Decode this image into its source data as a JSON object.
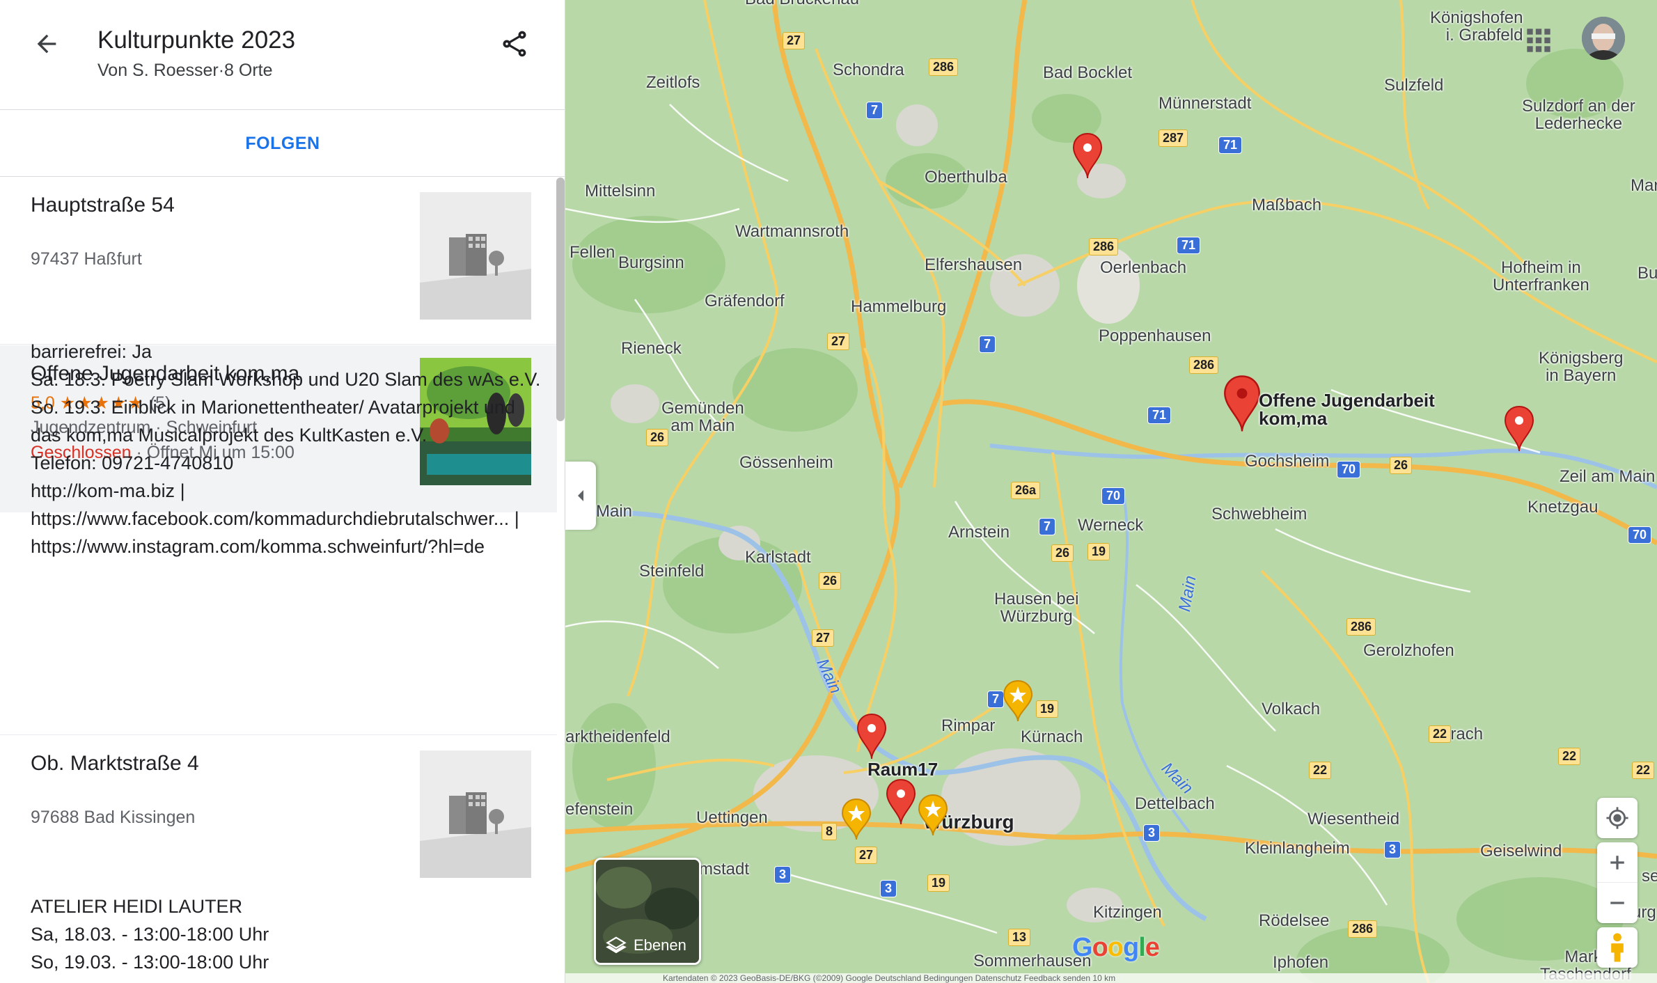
{
  "panel": {
    "title": "Kulturpunkte 2023",
    "subtitle": "Von S. Roesser·8 Orte",
    "follow_label": "FOLGEN",
    "items": [
      {
        "name": "Hauptstraße 54",
        "address": "97437 Haßfurt"
      },
      {
        "name": "Offene Jugendarbeit kom,ma",
        "rating": "5,0",
        "stars": "★★★★★",
        "review_count": "(5)",
        "category": "Jugendzentrum · Schweinfurt",
        "status": "Geschlossen",
        "hours": "· Öffnet Mi um 15:00",
        "description_lines": [
          "barrierefrei: Ja",
          "Sa. 18.3. Poetry Slam Workshop und U20 Slam des wAs e.V.",
          "So. 19.3. Einblick in Marionettentheater/ Avatarprojekt und",
          "das kom,ma Musicalprojekt des KultKasten e.V.",
          "Telefon: 09721-4740810",
          "http://kom-ma.biz |",
          "https://www.facebook.com/kommadurchdiebrutalschwer... |",
          "https://www.instagram.com/komma.schweinfurt/?hl=de"
        ]
      },
      {
        "name": "Ob. Marktstraße 4",
        "address": "97688 Bad Kissingen",
        "description_lines": [
          "ATELIER HEIDI LAUTER",
          "Sa, 18.03. - 13:00-18:00 Uhr",
          "So, 19.03. - 13:00-18:00 Uhr"
        ]
      }
    ]
  },
  "map": {
    "places": [
      {
        "name": "Bad Brückenau"
      },
      {
        "name": "Zeitlofs"
      },
      {
        "name": "Schondra"
      },
      {
        "name": "Bad Bocklet"
      },
      {
        "name": "Königshofen\ni. Grabfeld"
      },
      {
        "name": "Sulzfeld"
      },
      {
        "name": "Sulzdorf an der\nLederhecke"
      },
      {
        "name": "Münnerstadt"
      },
      {
        "name": "Mittelsinn"
      },
      {
        "name": "Oberthulba"
      },
      {
        "name": "Maßbach"
      },
      {
        "name": "Maro"
      },
      {
        "name": "Wartmannsroth"
      },
      {
        "name": "Fellen"
      },
      {
        "name": "Burgsinn"
      },
      {
        "name": "Elfershausen"
      },
      {
        "name": "Oerlenbach"
      },
      {
        "name": "Hofheim in\nUnterfranken"
      },
      {
        "name": "Burgp"
      },
      {
        "name": "Gräfendorf"
      },
      {
        "name": "Hammelburg"
      },
      {
        "name": "Poppenhausen"
      },
      {
        "name": "Rieneck"
      },
      {
        "name": "Königsberg\nin Bayern"
      },
      {
        "name": "Gemünden\nam Main"
      },
      {
        "name": "Gochsheim"
      },
      {
        "name": "Gössenheim"
      },
      {
        "name": "Zeil am Main"
      },
      {
        "name": "Main"
      },
      {
        "name": "Knetzgau"
      },
      {
        "name": "Schwebheim"
      },
      {
        "name": "Arnstein"
      },
      {
        "name": "Werneck"
      },
      {
        "name": "Karlstadt"
      },
      {
        "name": "Steinfeld"
      },
      {
        "name": "Hausen bei\nWürzburg"
      },
      {
        "name": "Gerolzhofen"
      },
      {
        "name": "Rimpar"
      },
      {
        "name": "Volkach"
      },
      {
        "name": "Kürnach"
      },
      {
        "name": "arktheidenfeld"
      },
      {
        "name": "Ebrach"
      },
      {
        "name": "Dettelbach"
      },
      {
        "name": "efenstein"
      },
      {
        "name": "Uettingen"
      },
      {
        "name": "Wiesentheid"
      },
      {
        "name": "Geiselwind"
      },
      {
        "name": "Kleinlangheim"
      },
      {
        "name": "mstadt"
      },
      {
        "name": "Kitzingen"
      },
      {
        "name": "Rödelsee"
      },
      {
        "name": "Sommerhausen"
      },
      {
        "name": "Iphofen"
      },
      {
        "name": "Markt\nTaschendorf"
      },
      {
        "name": "Burg"
      },
      {
        "name": "se"
      },
      {
        "name": "Würzburg"
      }
    ],
    "rivers": [
      "Main",
      "Main",
      "Main"
    ],
    "road_shields": {
      "yellow": [
        "27",
        "286",
        "287",
        "286",
        "27",
        "286",
        "26",
        "26",
        "26a",
        "26",
        "19",
        "26",
        "27",
        "286",
        "19",
        "22",
        "22",
        "22",
        "22",
        "8",
        "27",
        "19",
        "13",
        "286"
      ],
      "blue": [
        "7",
        "71",
        "71",
        "7",
        "71",
        "70",
        "70",
        "7",
        "70",
        "7",
        "3",
        "3",
        "3",
        "3"
      ]
    },
    "pin_label": "Offene Jugendarbeit\nkom,ma",
    "raum_label": "Raum17",
    "layers_label": "Ebenen",
    "google_logo": "Google",
    "attribution": "Kartendaten © 2023 GeoBasis-DE/BKG (©2009) Google    Deutschland    Bedingungen    Datenschutz    Feedback senden    10 km"
  },
  "colors": {
    "accent": "#1a73e8",
    "closed": "#d93025",
    "rating": "#e8710a",
    "pin_red": "#ea4335",
    "star_yellow": "#f4b400",
    "map_green": "#b8d8a8",
    "road_yellow": "#f6cf65"
  }
}
